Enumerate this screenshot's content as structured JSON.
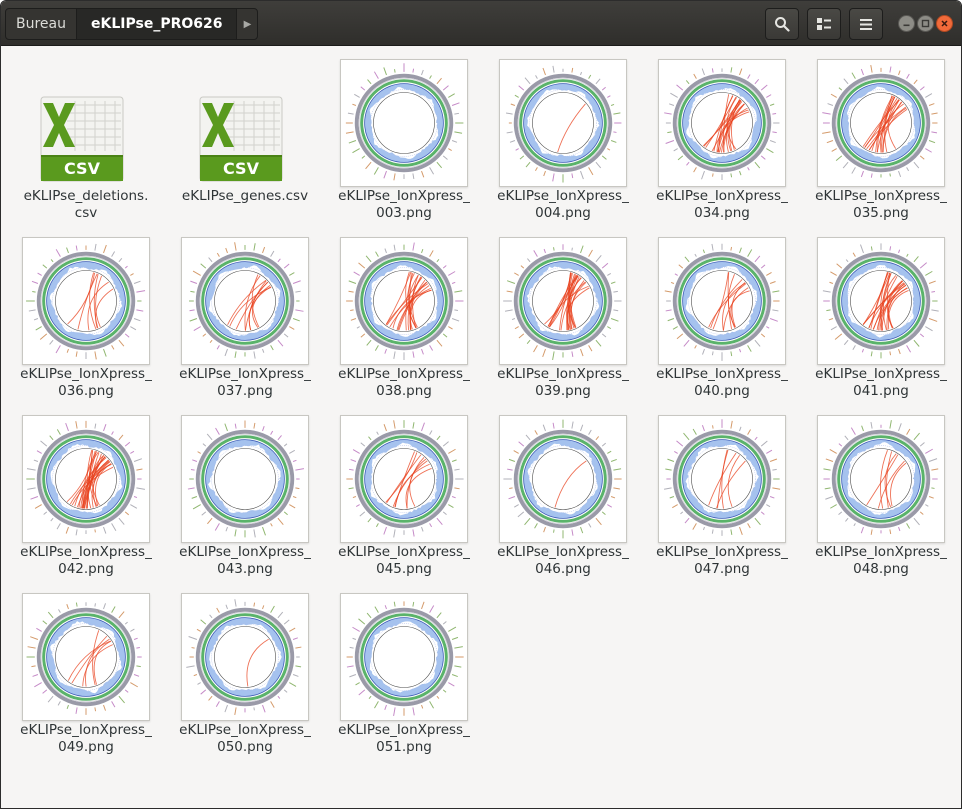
{
  "headerbar": {
    "crumbs": [
      "Bureau",
      "eKLIPse_PRO626"
    ],
    "buttons": {
      "search": "search-icon",
      "view": "view-options-icon",
      "menu": "hamburger-menu-icon"
    },
    "window_controls": [
      "minimize-icon",
      "maximize-icon",
      "close-icon"
    ]
  },
  "files": [
    {
      "type": "csv",
      "line1": "eKLIPse_deletions.",
      "line2": "csv",
      "icon_text": "CSV"
    },
    {
      "type": "csv",
      "line1": "eKLIPse_genes.csv",
      "line2": "",
      "icon_text": "CSV"
    },
    {
      "type": "png",
      "line1": "eKLIPse_IonXpress_",
      "line2": "003.png",
      "arcs": 0
    },
    {
      "type": "png",
      "line1": "eKLIPse_IonXpress_",
      "line2": "004.png",
      "arcs": 1
    },
    {
      "type": "png",
      "line1": "eKLIPse_IonXpress_",
      "line2": "034.png",
      "arcs": 18
    },
    {
      "type": "png",
      "line1": "eKLIPse_IonXpress_",
      "line2": "035.png",
      "arcs": 16
    },
    {
      "type": "png",
      "line1": "eKLIPse_IonXpress_",
      "line2": "036.png",
      "arcs": 7
    },
    {
      "type": "png",
      "line1": "eKLIPse_IonXpress_",
      "line2": "037.png",
      "arcs": 9
    },
    {
      "type": "png",
      "line1": "eKLIPse_IonXpress_",
      "line2": "038.png",
      "arcs": 18
    },
    {
      "type": "png",
      "line1": "eKLIPse_IonXpress_",
      "line2": "039.png",
      "arcs": 20
    },
    {
      "type": "png",
      "line1": "eKLIPse_IonXpress_",
      "line2": "040.png",
      "arcs": 9
    },
    {
      "type": "png",
      "line1": "eKLIPse_IonXpress_",
      "line2": "041.png",
      "arcs": 20
    },
    {
      "type": "png",
      "line1": "eKLIPse_IonXpress_",
      "line2": "042.png",
      "arcs": 24
    },
    {
      "type": "png",
      "line1": "eKLIPse_IonXpress_",
      "line2": "043.png",
      "arcs": 0
    },
    {
      "type": "png",
      "line1": "eKLIPse_IonXpress_",
      "line2": "045.png",
      "arcs": 8
    },
    {
      "type": "png",
      "line1": "eKLIPse_IonXpress_",
      "line2": "046.png",
      "arcs": 1
    },
    {
      "type": "png",
      "line1": "eKLIPse_IonXpress_",
      "line2": "047.png",
      "arcs": 5
    },
    {
      "type": "png",
      "line1": "eKLIPse_IonXpress_",
      "line2": "048.png",
      "arcs": 6
    },
    {
      "type": "png",
      "line1": "eKLIPse_IonXpress_",
      "line2": "049.png",
      "arcs": 6
    },
    {
      "type": "png",
      "line1": "eKLIPse_IonXpress_",
      "line2": "050.png",
      "arcs": 1
    },
    {
      "type": "png",
      "line1": "eKLIPse_IonXpress_",
      "line2": "051.png",
      "arcs": 0
    }
  ],
  "colors": {
    "arc": "#e8401c",
    "outer_ring": "#9a9aa8",
    "green_ring": "#5ab36a",
    "blue_coverage": "#5b8fe0",
    "csv_green": "#5a9a1e"
  }
}
